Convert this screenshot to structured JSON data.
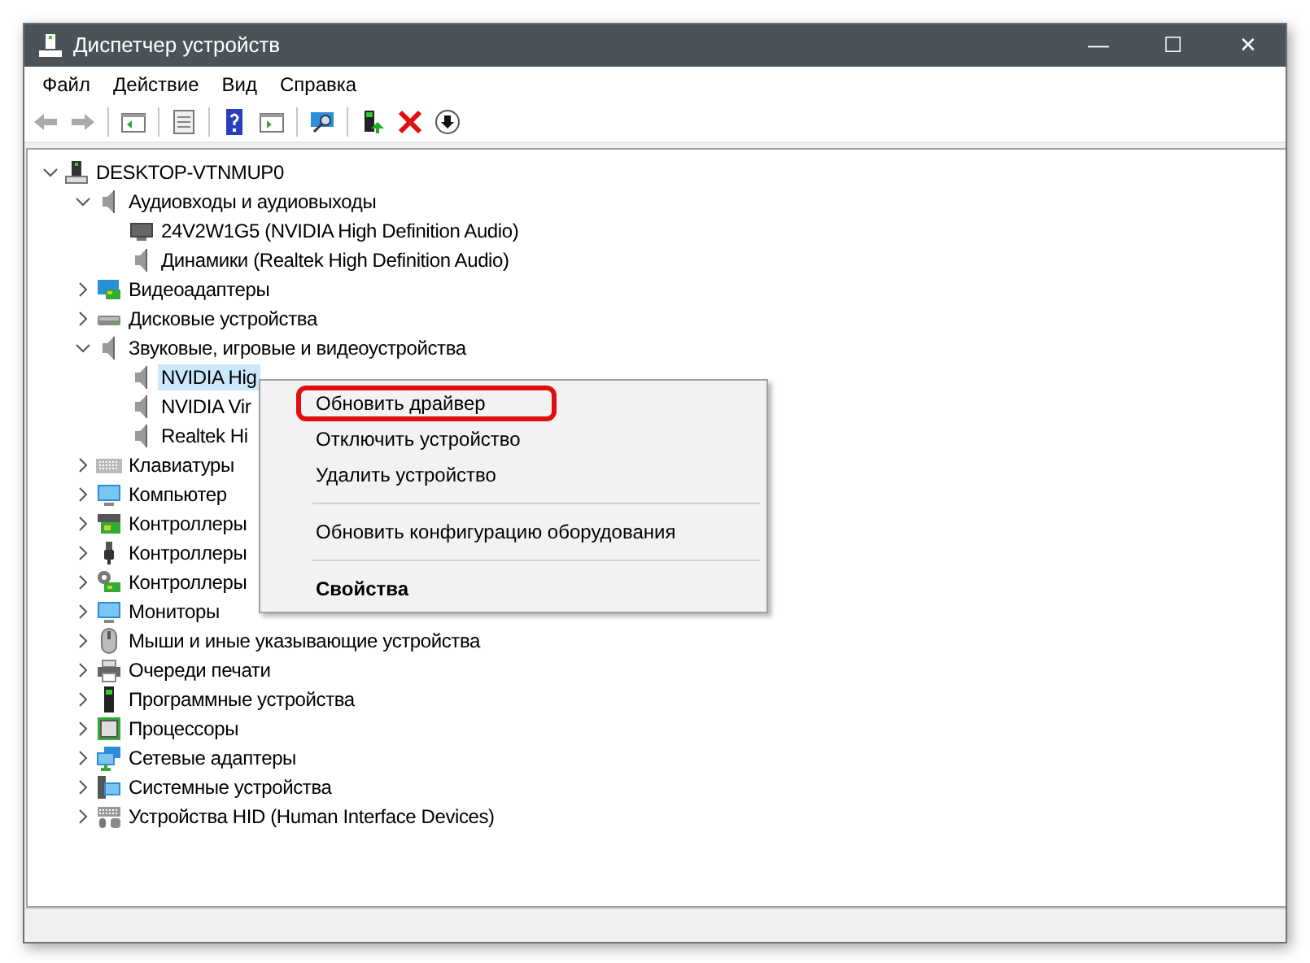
{
  "window": {
    "title": "Диспетчер устройств",
    "controls": [
      "—",
      "☐",
      "✕"
    ]
  },
  "menu_bar": [
    "Файл",
    "Действие",
    "Вид",
    "Справка"
  ],
  "tree": {
    "label": "DESKTOP-VTNMUP0",
    "kind": "computer",
    "expanded": true,
    "children": [
      {
        "label": "Аудиовходы и аудиовыходы",
        "kind": "speaker",
        "expanded": true,
        "children": [
          {
            "label": "24V2W1G5 (NVIDIA High Definition Audio)",
            "kind": "monitor",
            "selected": false
          },
          {
            "label": "Динамики (Realtek High Definition Audio)",
            "kind": "speaker",
            "selected": false
          }
        ]
      },
      {
        "label": "Видеоадаптеры",
        "kind": "display",
        "expanded": false
      },
      {
        "label": "Дисковые устройства",
        "kind": "disk",
        "expanded": false
      },
      {
        "label": "Звуковые, игровые и видеоустройства",
        "kind": "speaker",
        "expanded": true,
        "children": [
          {
            "label": "NVIDIA Hig",
            "kind": "speaker",
            "selected": true
          },
          {
            "label": "NVIDIA Vir",
            "kind": "speaker",
            "selected": false
          },
          {
            "label": "Realtek Hi",
            "kind": "speaker",
            "selected": false
          }
        ]
      },
      {
        "label": "Клавиатуры",
        "kind": "keyboard",
        "expanded": false
      },
      {
        "label": "Компьютер",
        "kind": "monitor2",
        "expanded": false
      },
      {
        "label": "Контроллеры",
        "kind": "controller",
        "expanded": false
      },
      {
        "label": "Контроллеры",
        "kind": "usb",
        "expanded": false
      },
      {
        "label": "Контроллеры",
        "kind": "storage",
        "expanded": false
      },
      {
        "label": "Мониторы",
        "kind": "monitor2",
        "expanded": false
      },
      {
        "label": "Мыши и иные указывающие устройства",
        "kind": "mouse",
        "expanded": false
      },
      {
        "label": "Очереди печати",
        "kind": "printer",
        "expanded": false
      },
      {
        "label": "Программные устройства",
        "kind": "software",
        "expanded": false
      },
      {
        "label": "Процессоры",
        "kind": "cpu",
        "expanded": false
      },
      {
        "label": "Сетевые адаптеры",
        "kind": "network",
        "expanded": false
      },
      {
        "label": "Системные устройства",
        "kind": "system",
        "expanded": false
      },
      {
        "label": "Устройства HID (Human Interface Devices)",
        "kind": "hid",
        "expanded": false
      }
    ]
  },
  "context_menu": {
    "items": [
      {
        "kind": "item",
        "label": "Обновить драйвер",
        "default": false,
        "highlighted": true
      },
      {
        "kind": "item",
        "label": "Отключить устройство",
        "default": false,
        "highlighted": false
      },
      {
        "kind": "item",
        "label": "Удалить устройство",
        "default": false,
        "highlighted": false
      },
      {
        "kind": "separator"
      },
      {
        "kind": "item",
        "label": "Обновить конфигурацию оборудования",
        "default": false,
        "highlighted": false
      },
      {
        "kind": "separator"
      },
      {
        "kind": "item",
        "label": "Свойства",
        "default": true,
        "highlighted": false
      }
    ]
  }
}
